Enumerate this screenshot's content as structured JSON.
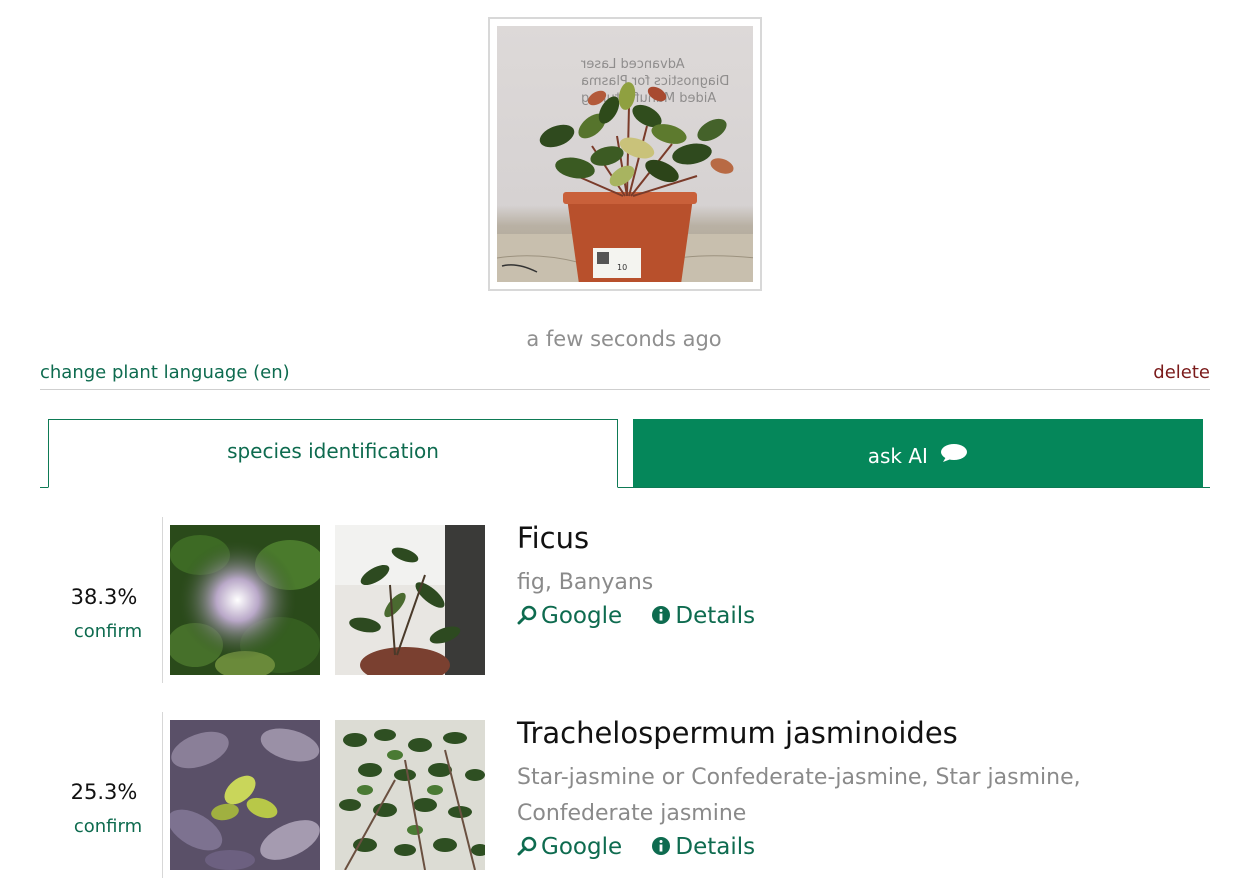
{
  "photo": {
    "wall_text": "Advanced Laser Diagnostics for Plasma Aided Manufacturing",
    "pot_label": "10"
  },
  "timestamp": "a few seconds ago",
  "meta": {
    "change_language": "change plant language (en)",
    "delete": "delete"
  },
  "tabs": {
    "species": "species identification",
    "ask_ai": "ask AI"
  },
  "results": [
    {
      "percent": "38.3%",
      "confirm": "confirm",
      "name": "Ficus",
      "common": "fig, Banyans",
      "google": "Google",
      "details": "Details"
    },
    {
      "percent": "25.3%",
      "confirm": "confirm",
      "name": "Trachelospermum jasminoides",
      "common": "Star-jasmine or Confederate-jasmine, Star jasmine, Confederate jasmine",
      "google": "Google",
      "details": "Details"
    }
  ],
  "colors": {
    "accent": "#05875a",
    "link": "#0e6b4f",
    "delete": "#7a1a1a",
    "muted": "#8f8f8f"
  },
  "icons": [
    "chat-icon",
    "search-icon",
    "info-icon"
  ]
}
